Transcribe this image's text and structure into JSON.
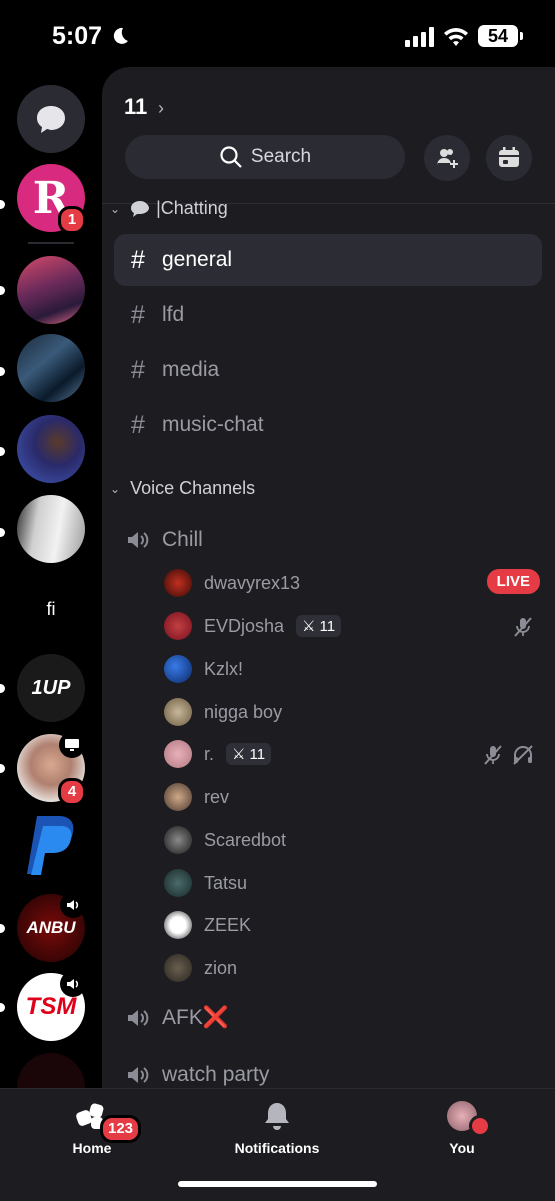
{
  "status": {
    "time": "5:07",
    "battery": "54"
  },
  "rail": {
    "servers": [
      {
        "name": "direct-messages",
        "initial": ""
      },
      {
        "name": "server-r",
        "initial": "R",
        "badge": "1"
      },
      {
        "name": "server-2"
      },
      {
        "name": "server-3"
      },
      {
        "name": "server-4"
      },
      {
        "name": "server-5"
      },
      {
        "name": "server-fi",
        "initial": "fi"
      },
      {
        "name": "server-1up",
        "initial": "1UP"
      },
      {
        "name": "server-person",
        "badge": "4"
      },
      {
        "name": "server-paypal"
      },
      {
        "name": "server-anbu",
        "initial": "ANBU"
      },
      {
        "name": "server-tsm",
        "initial": "TSM"
      }
    ]
  },
  "server": {
    "title": "11",
    "search": "Search"
  },
  "categories": {
    "chatting": "|Chatting",
    "voice": "Voice Channels"
  },
  "text_channels": [
    "general",
    "lfd",
    "media",
    "music-chat"
  ],
  "voice_channels": {
    "chill": "Chill",
    "afk": "AFK",
    "afk_mark": "❌",
    "watch": "watch party"
  },
  "voice_users": [
    {
      "name": "dwavyrex13",
      "live": "LIVE"
    },
    {
      "name": "EVDjosha",
      "tag": "11"
    },
    {
      "name": "Kzlx!"
    },
    {
      "name": "nigga boy"
    },
    {
      "name": "r.",
      "tag": "11"
    },
    {
      "name": "rev"
    },
    {
      "name": "Scaredbot"
    },
    {
      "name": "Tatsu"
    },
    {
      "name": "ZEEK"
    },
    {
      "name": "zion"
    }
  ],
  "bottom_nav": {
    "home": "Home",
    "home_badge": "123",
    "notifications": "Notifications",
    "you": "You"
  }
}
